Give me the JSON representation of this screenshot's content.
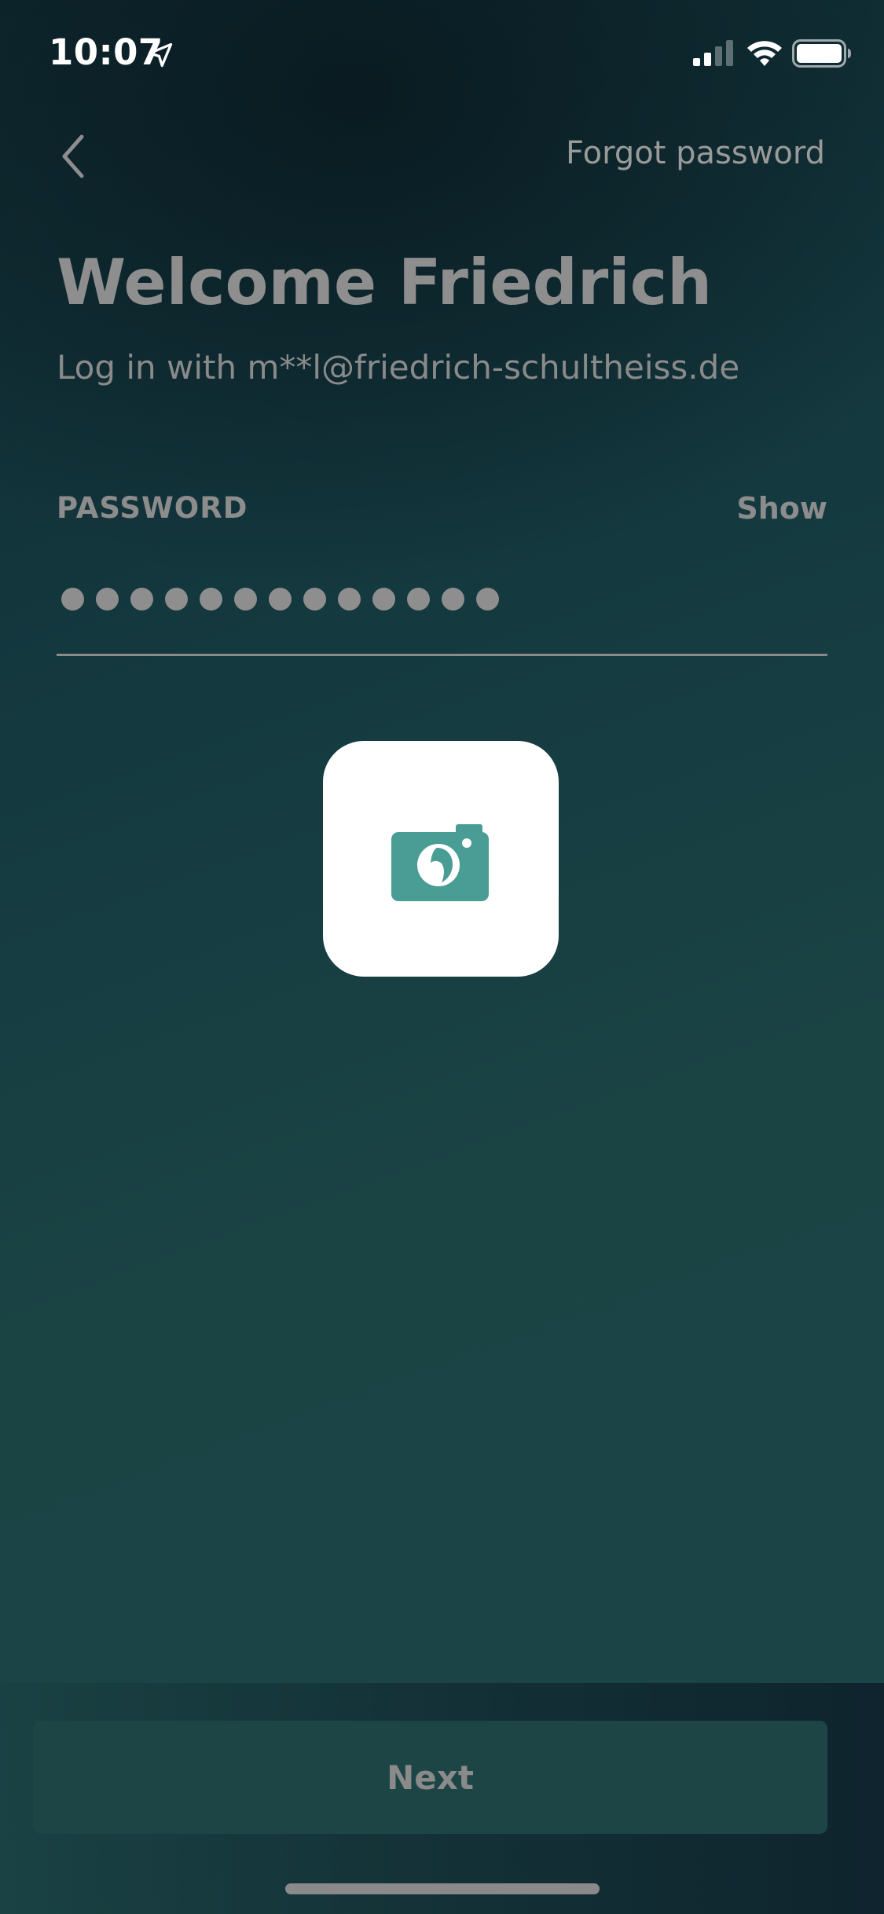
{
  "status_bar": {
    "time": "10:07",
    "location_icon": "location-arrow-icon",
    "signal_icon": "cellular-signal-icon",
    "wifi_icon": "wifi-icon",
    "battery_icon": "battery-icon"
  },
  "nav": {
    "back_icon": "chevron-left-icon",
    "forgot_password_label": "Forgot password"
  },
  "header": {
    "title": "Welcome Friedrich",
    "subtitle": "Log in with m**l@friedrich-schultheiss.de"
  },
  "password": {
    "label": "PASSWORD",
    "show_label": "Show",
    "masked_length": 13
  },
  "app_icon": {
    "icon": "camera-icon",
    "accent_color": "#4a9d94"
  },
  "footer": {
    "next_label": "Next"
  },
  "colors": {
    "background_top": "#0f2a31",
    "background_bottom": "#1b4547",
    "muted_text": "#8e8e8e",
    "button_bg": "#1e4546"
  }
}
